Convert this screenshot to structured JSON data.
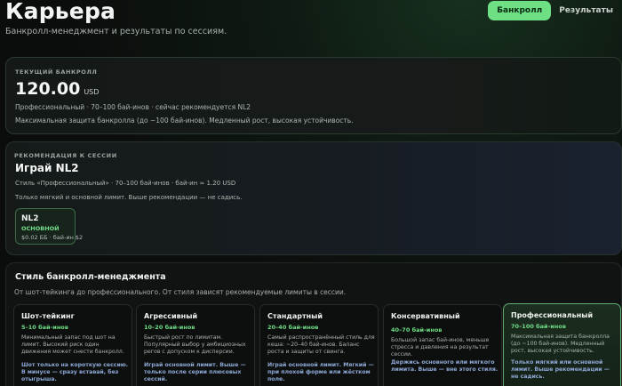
{
  "header": {
    "title": "Карьера",
    "subtitle": "Банкролл-менеджмент и результаты по сессиям.",
    "tabs": [
      {
        "label": "Банкролл",
        "active": true
      },
      {
        "label": "Результаты",
        "active": false
      }
    ]
  },
  "bankroll": {
    "eyebrow": "Текущий банкролл",
    "amount": "120.00",
    "currency": "USD",
    "line1": "Профессиональный · 70–100 бай-инов · сейчас рекомендуется NL2",
    "line2": "Максимальная защита банкролла (до ~100 бай-инов). Медленный рост, высокая устойчивость."
  },
  "recommendation": {
    "eyebrow": "Рекомендация к сессии",
    "heading": "Играй NL2",
    "line1": "Стиль «Профессиональный» · 70–100 бай-инов · бай-ин ≈ 1.20 USD",
    "line2": "Только мягкий и основной лимит. Выше рекомендации — не садись.",
    "limit": {
      "name": "NL2",
      "tag": "ОСНОВНОЙ",
      "blinds": "$0.02 ББ · бай-ин $2"
    }
  },
  "styles": {
    "title": "Стиль банкролл-менеджмента",
    "description": "От шот-тейкинга до профессионального. От стиля зависят рекомендуемые лимиты в сессии.",
    "items": [
      {
        "name": "Шот-тейкинг",
        "range": "5–10 бай-инов",
        "text": "Минимальный запас под шот на лимит. Высокий риск один движения может снести банкролл.",
        "advice": "Шот только на короткую сессию. В минусе — сразу вставай, без отыгрыша.",
        "selected": false
      },
      {
        "name": "Агрессивный",
        "range": "10–20 бай-инов",
        "text": "Быстрый рост по лимитам. Популярный выбор у амбициозных регов с допуском к дисперсии.",
        "advice": "Играй основной лимит. Выше — только после серии плюсовых сессий.",
        "selected": false
      },
      {
        "name": "Стандартный",
        "range": "20–40 бай-инов",
        "text": "Самый распространённый стиль для кеша: ~20–40 бай-инов. Баланс роста и защиты от свинга.",
        "advice": "Играй основной лимит. Мягкий — при плохой форме или жёстком поле.",
        "selected": false
      },
      {
        "name": "Консервативный",
        "range": "40–70 бай-инов",
        "text": "Большой запас бай-инов, меньше стресса и давления на результат сессии.",
        "advice": "Держись основного или мягкого лимита. Выше — вне этого стиля.",
        "selected": false
      },
      {
        "name": "Профессиональный",
        "range": "70–100 бай-инов",
        "text": "Максимальная защита банкролла (до ~100 бай-инов). Медленный рост, высокая устойчивость.",
        "advice": "Только мягкий или основной лимит. Выше рекомендации — не садись.",
        "selected": true
      }
    ]
  },
  "colors": {
    "accent": "#6ee083",
    "advice": "#8fa9d8",
    "background": "#0b0d0c"
  }
}
